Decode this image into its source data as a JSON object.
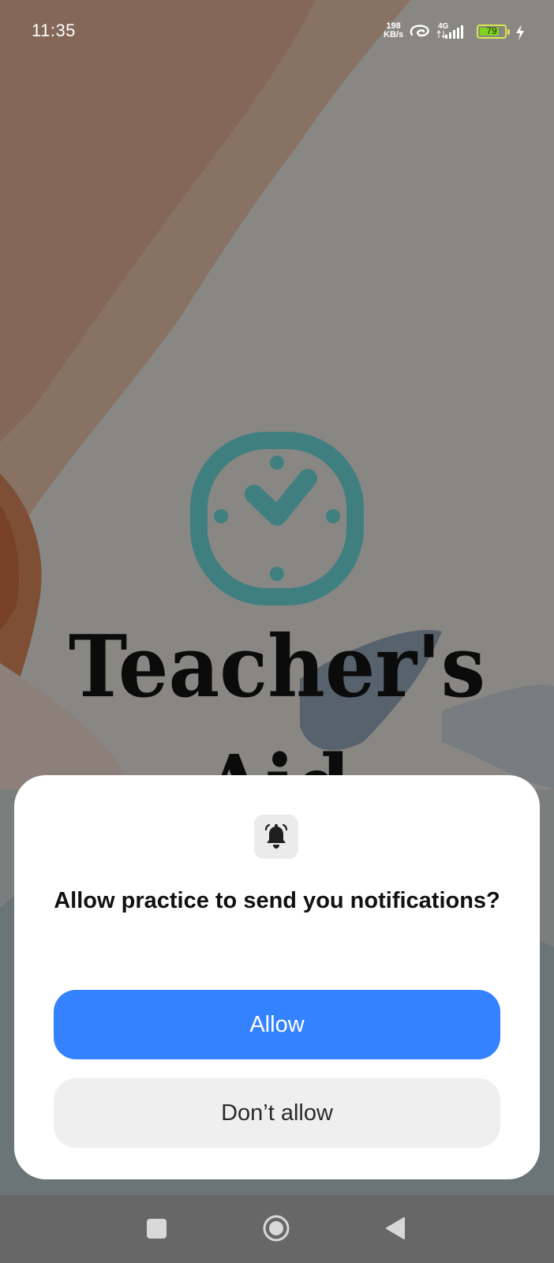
{
  "status_bar": {
    "time": "11:35",
    "speed_value": "198",
    "speed_unit": "KB/s",
    "network_type": "4G",
    "battery_level": "79",
    "battery_fraction": 0.79,
    "icons": [
      "hotspot-link-icon",
      "signal-icon",
      "battery-icon",
      "charging-bolt-icon"
    ]
  },
  "app": {
    "name_line1": "Teacher's",
    "name_line2": "Aid",
    "logo_icon": "clock-icon",
    "logo_color": "#3f7f80"
  },
  "dialog": {
    "icon": "bell-icon",
    "title": "Allow practice to send you notifications?",
    "allow_label": "Allow",
    "deny_label": "Don’t allow",
    "allow_color": "#3482ff"
  },
  "nav_bar": {
    "icons": [
      "recents-square-icon",
      "home-circle-icon",
      "back-triangle-icon"
    ]
  }
}
